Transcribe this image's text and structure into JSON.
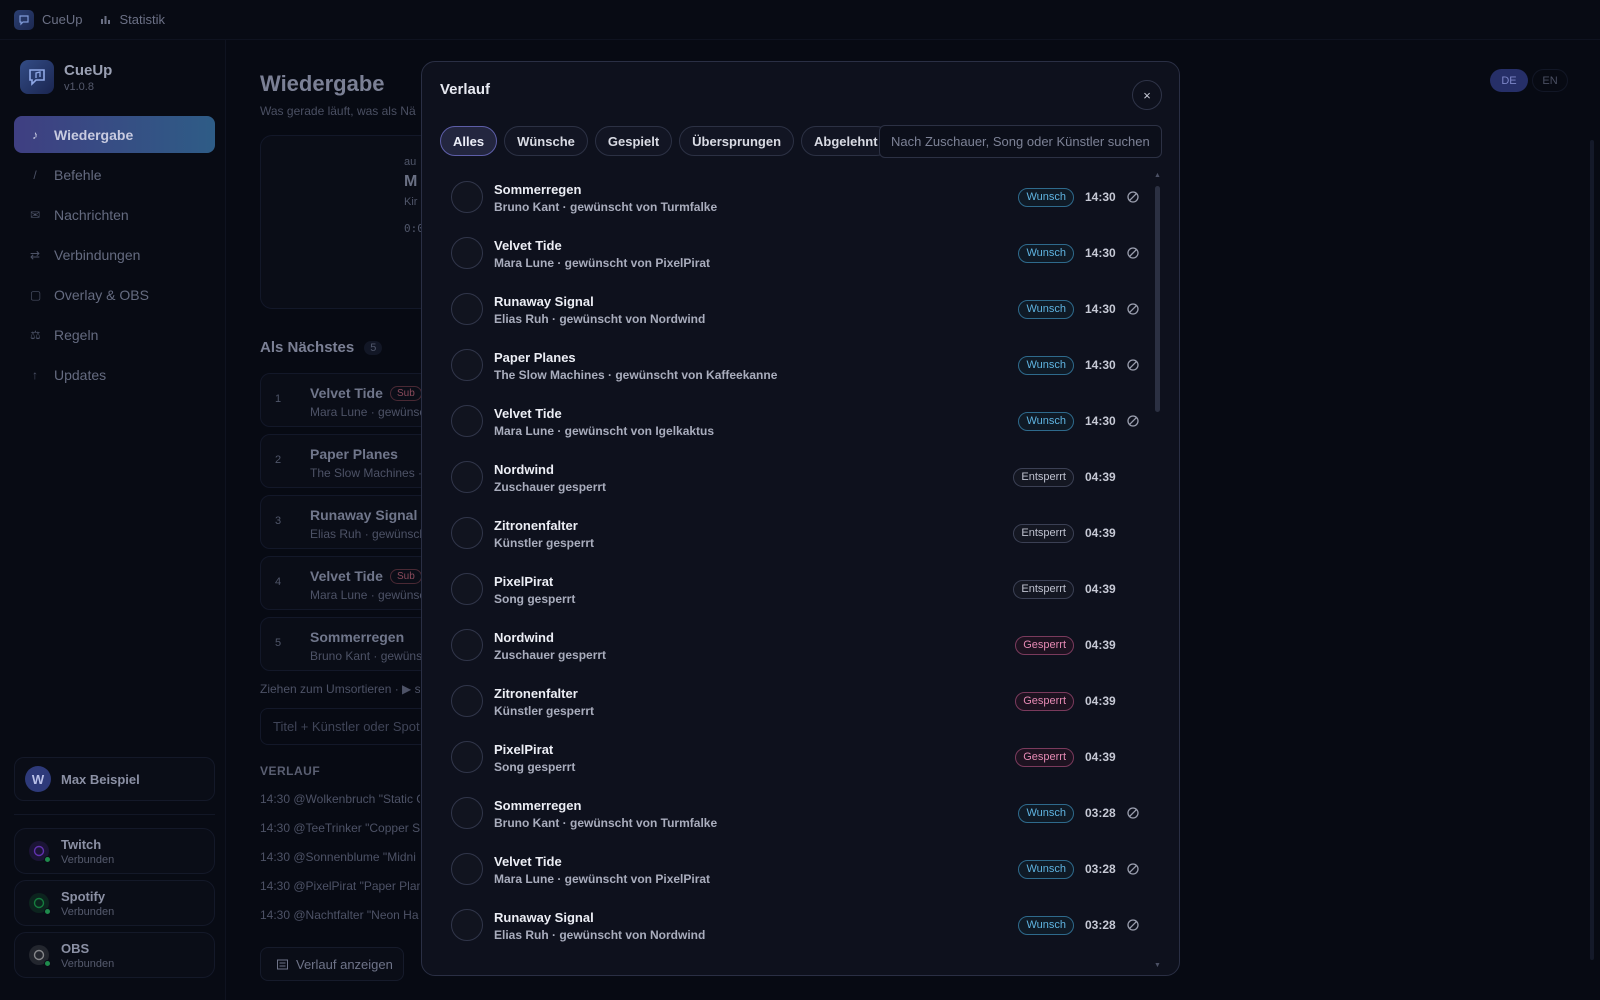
{
  "topbar": {
    "app_label": "CueUp",
    "stats_label": "Statistik"
  },
  "brand": {
    "name": "CueUp",
    "version": "v1.0.8"
  },
  "nav": [
    {
      "label": "Wiedergabe",
      "glyph": "♪",
      "icon": "music-note-icon",
      "active": true
    },
    {
      "label": "Befehle",
      "glyph": "/",
      "icon": "slash-icon"
    },
    {
      "label": "Nachrichten",
      "glyph": "✉",
      "icon": "mail-icon"
    },
    {
      "label": "Verbindungen",
      "glyph": "⇄",
      "icon": "swap-icon"
    },
    {
      "label": "Overlay & OBS",
      "glyph": "▢",
      "icon": "overlay-icon"
    },
    {
      "label": "Regeln",
      "glyph": "⚖",
      "icon": "scale-icon"
    },
    {
      "label": "Updates",
      "glyph": "↑",
      "icon": "arrow-up-icon"
    }
  ],
  "user": {
    "initial": "W",
    "name": "Max Beispiel"
  },
  "connections": [
    {
      "name": "Twitch",
      "status": "Verbunden",
      "color": "#9146ff",
      "icon": "twitch-icon"
    },
    {
      "name": "Spotify",
      "status": "Verbunden",
      "color": "#1db954",
      "icon": "spotify-icon"
    },
    {
      "name": "OBS",
      "status": "Verbunden",
      "color": "#c8c8c8",
      "icon": "obs-icon"
    }
  ],
  "main": {
    "title": "Wiedergabe",
    "subtitle": "Was gerade läuft, was als Nä",
    "np_fragments": [
      "au",
      "M",
      "Kir",
      "0:0"
    ],
    "lang_de": "DE",
    "lang_en": "EN",
    "next_heading": "Als Nächstes",
    "next_count": "5",
    "queue": [
      {
        "num": "1",
        "title": "Velvet Tide",
        "sub": "Mara Lune · gewünsc",
        "badge": "Sub"
      },
      {
        "num": "2",
        "title": "Paper Planes",
        "sub": "The Slow Machines ·",
        "badge": ""
      },
      {
        "num": "3",
        "title": "Runaway Signal",
        "sub": "Elias Ruh · gewünscht",
        "badge": ""
      },
      {
        "num": "4",
        "title": "Velvet Tide",
        "sub": "Mara Lune · gewünsc",
        "badge": "Sub"
      },
      {
        "num": "5",
        "title": "Sommerregen",
        "sub": "Bruno Kant · gewünsc",
        "badge": ""
      }
    ],
    "hint": "Ziehen zum Umsortieren · ▶ s",
    "add_placeholder": "Titel + Künstler oder Spot",
    "history_heading": "VERLAUF",
    "history_lines": [
      "14:30 @Wolkenbruch \"Static C",
      "14:30 @TeeTrinker \"Copper Sk",
      "14:30 @Sonnenblume \"Midni",
      "14:30 @PixelPirat \"Paper Plan",
      "14:30 @Nachtfalter \"Neon Ha"
    ],
    "history_button": "Verlauf anzeigen"
  },
  "modal": {
    "title": "Verlauf",
    "close": "×",
    "filters": [
      "Alles",
      "Wünsche",
      "Gespielt",
      "Übersprungen",
      "Abgelehnt"
    ],
    "active_filter": 0,
    "search_placeholder": "Nach Zuschauer, Song oder Künstler suchen",
    "colors": {
      "wish": "#5fb3e0",
      "unlocked": "#bfc2cf",
      "locked": "#e58ab4"
    },
    "rows": [
      {
        "title": "Sommerregen",
        "sub": "Bruno Kant · gewünscht von Turmfalke",
        "badge": "Wunsch",
        "type": "wish",
        "time": "14:30",
        "reject": true
      },
      {
        "title": "Velvet Tide",
        "sub": "Mara Lune · gewünscht von PixelPirat",
        "badge": "Wunsch",
        "type": "wish",
        "time": "14:30",
        "reject": true
      },
      {
        "title": "Runaway Signal",
        "sub": "Elias Ruh · gewünscht von Nordwind",
        "badge": "Wunsch",
        "type": "wish",
        "time": "14:30",
        "reject": true
      },
      {
        "title": "Paper Planes",
        "sub": "The Slow Machines · gewünscht von Kaffeekanne",
        "badge": "Wunsch",
        "type": "wish",
        "time": "14:30",
        "reject": true
      },
      {
        "title": "Velvet Tide",
        "sub": "Mara Lune · gewünscht von Igelkaktus",
        "badge": "Wunsch",
        "type": "wish",
        "time": "14:30",
        "reject": true
      },
      {
        "title": "Nordwind",
        "sub": "Zuschauer gesperrt",
        "badge": "Entsperrt",
        "type": "unlocked",
        "time": "04:39",
        "reject": false
      },
      {
        "title": "Zitronenfalter",
        "sub": "Künstler gesperrt",
        "badge": "Entsperrt",
        "type": "unlocked",
        "time": "04:39",
        "reject": false
      },
      {
        "title": "PixelPirat",
        "sub": "Song gesperrt",
        "badge": "Entsperrt",
        "type": "unlocked",
        "time": "04:39",
        "reject": false
      },
      {
        "title": "Nordwind",
        "sub": "Zuschauer gesperrt",
        "badge": "Gesperrt",
        "type": "locked",
        "time": "04:39",
        "reject": false
      },
      {
        "title": "Zitronenfalter",
        "sub": "Künstler gesperrt",
        "badge": "Gesperrt",
        "type": "locked",
        "time": "04:39",
        "reject": false
      },
      {
        "title": "PixelPirat",
        "sub": "Song gesperrt",
        "badge": "Gesperrt",
        "type": "locked",
        "time": "04:39",
        "reject": false
      },
      {
        "title": "Sommerregen",
        "sub": "Bruno Kant · gewünscht von Turmfalke",
        "badge": "Wunsch",
        "type": "wish",
        "time": "03:28",
        "reject": true
      },
      {
        "title": "Velvet Tide",
        "sub": "Mara Lune · gewünscht von PixelPirat",
        "badge": "Wunsch",
        "type": "wish",
        "time": "03:28",
        "reject": true
      },
      {
        "title": "Runaway Signal",
        "sub": "Elias Ruh · gewünscht von Nordwind",
        "badge": "Wunsch",
        "type": "wish",
        "time": "03:28",
        "reject": true
      }
    ]
  }
}
